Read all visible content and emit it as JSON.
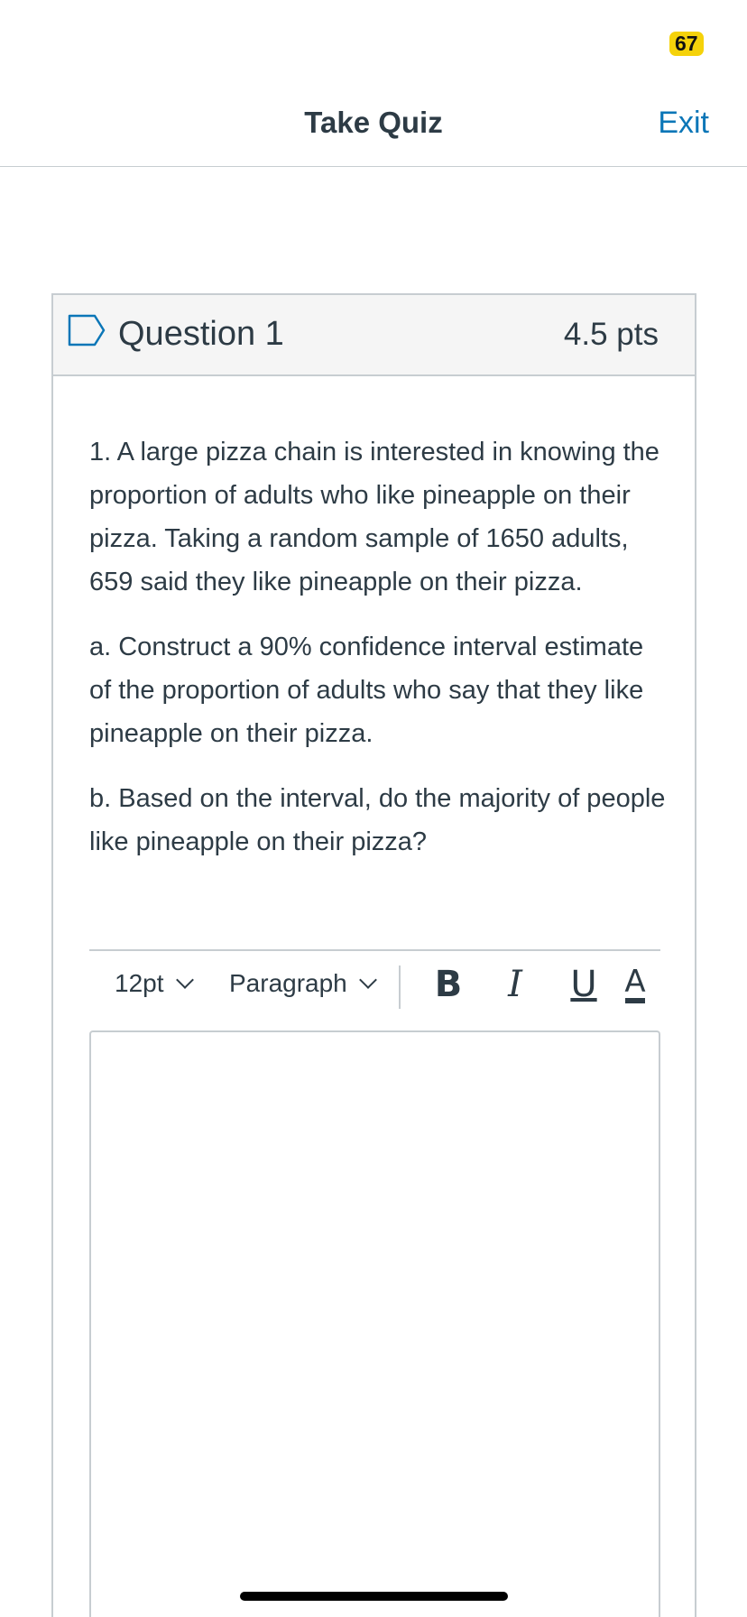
{
  "status_bar": {
    "badge": "67"
  },
  "header": {
    "title": "Take Quiz",
    "exit_label": "Exit"
  },
  "question": {
    "title": "Question 1",
    "points": "4.5 pts",
    "paragraphs": [
      "1. A large pizza chain is interested in knowing the proportion of adults who like pineapple on their pizza. Taking a random sample of 1650 adults, 659 said they like pineapple on their pizza.",
      "a. Construct a 90% confidence interval estimate of the proportion of adults who say that they like pineapple on their pizza.",
      "b. Based on the interval, do the majority of people like pineapple on their pizza?"
    ]
  },
  "editor": {
    "font_size": "12pt",
    "block_format": "Paragraph",
    "bold_label": "B",
    "italic_label": "I",
    "underline_label": "U",
    "text_color_label": "A",
    "answer_value": ""
  },
  "colors": {
    "badge": "#f5d20a",
    "link": "#0b76b7",
    "text": "#2d3b45",
    "border": "#c7cdd1",
    "header_bg": "#f5f5f5"
  },
  "icons": {
    "flag": "flag-icon",
    "dropdown": "chevron-down-icon"
  }
}
